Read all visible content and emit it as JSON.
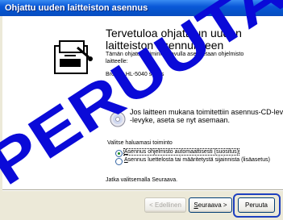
{
  "title": "Ohjattu uuden laitteiston asennus",
  "heading": "Tervetuloa ohjattuun uuden laitteiston asennukseen",
  "intro_line1": "Tämän ohjatun toiminnon avulla asennetaan ohjelmisto",
  "intro_line2": "laitteelle:",
  "device": "Brother HL-5040 series",
  "cd_line1": "Jos laitteen mukana toimitettiin asennus-CD-levy tai",
  "cd_line2": "-levyke, aseta se nyt asemaan.",
  "question": "Valitse haluamasi toiminto",
  "options": [
    {
      "mnemonic": "A",
      "rest": "sennus ohjelmisto automaattisesti (suositus)",
      "selected": true
    },
    {
      "mnemonic": "A",
      "rest": "sennus luettelosta tai määritetystä sijainnista (lisäasetus)",
      "selected": false
    }
  ],
  "continue_text": "Jatka valitsemalla Seuraava.",
  "buttons": {
    "back": "< Edellinen",
    "next_mnemonic": "S",
    "next_rest": "euraava >",
    "cancel": "Peruuta"
  },
  "stamp_text": "PERUUTA",
  "colors": {
    "stamp": "#0a0ad8",
    "titlebar": "#0a58d8"
  }
}
